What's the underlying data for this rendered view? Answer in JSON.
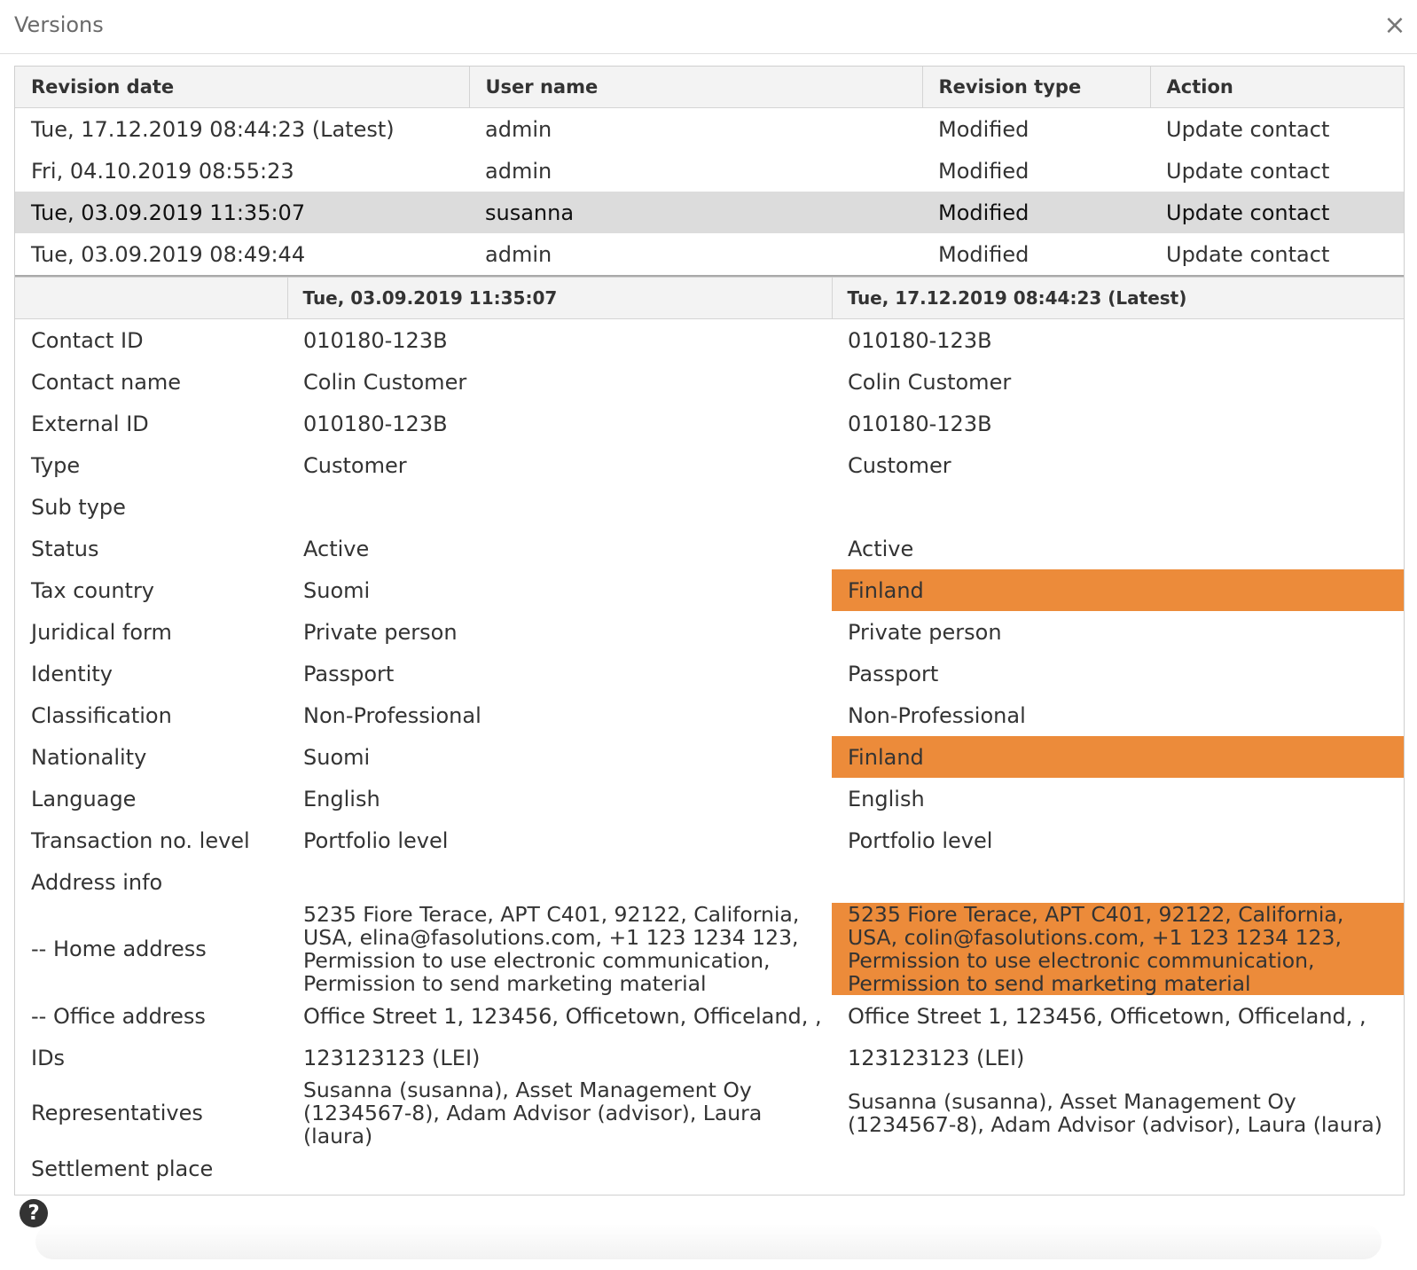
{
  "dialog": {
    "title": "Versions",
    "close_icon": "×",
    "help_icon": "?"
  },
  "colors": {
    "changed_highlight": "#ec8b3a",
    "selected_row": "#dcdcdc"
  },
  "revisions": {
    "headers": [
      "Revision date",
      "User name",
      "Revision type",
      "Action"
    ],
    "rows": [
      {
        "date": "Tue, 17.12.2019 08:44:23 (Latest)",
        "user": "admin",
        "type": "Modified",
        "action": "Update contact"
      },
      {
        "date": "Fri, 04.10.2019 08:55:23",
        "user": "admin",
        "type": "Modified",
        "action": "Update contact"
      },
      {
        "date": "Tue, 03.09.2019 11:35:07",
        "user": "susanna",
        "type": "Modified",
        "action": "Update contact",
        "selected": true
      },
      {
        "date": "Tue, 03.09.2019 08:49:44",
        "user": "admin",
        "type": "Modified",
        "action": "Update contact"
      }
    ]
  },
  "comparison": {
    "headers": [
      "",
      "Tue, 03.09.2019 11:35:07",
      "Tue, 17.12.2019 08:44:23 (Latest)"
    ],
    "rows": [
      {
        "label": "Contact ID",
        "old": "010180-123B",
        "new": "010180-123B",
        "changed": false
      },
      {
        "label": "Contact name",
        "old": "Colin Customer",
        "new": "Colin Customer",
        "changed": false
      },
      {
        "label": "External ID",
        "old": "010180-123B",
        "new": "010180-123B",
        "changed": false
      },
      {
        "label": "Type",
        "old": "Customer",
        "new": "Customer",
        "changed": false
      },
      {
        "label": "Sub type",
        "old": "",
        "new": "",
        "changed": false
      },
      {
        "label": "Status",
        "old": "Active",
        "new": "Active",
        "changed": false
      },
      {
        "label": "Tax country",
        "old": "Suomi",
        "new": "Finland",
        "changed": true
      },
      {
        "label": "Juridical form",
        "old": "Private person",
        "new": "Private person",
        "changed": false
      },
      {
        "label": "Identity",
        "old": "Passport",
        "new": "Passport",
        "changed": false
      },
      {
        "label": "Classification",
        "old": "Non-Professional",
        "new": "Non-Professional",
        "changed": false
      },
      {
        "label": "Nationality",
        "old": "Suomi",
        "new": "Finland",
        "changed": true
      },
      {
        "label": "Language",
        "old": "English",
        "new": "English",
        "changed": false
      },
      {
        "label": "Transaction no. level",
        "old": "Portfolio level",
        "new": "Portfolio level",
        "changed": false
      },
      {
        "label": "Address info",
        "old": "",
        "new": "",
        "changed": false
      },
      {
        "label": "-- Home address",
        "old": "5235 Fiore Terace, APT C401, 92122, California, USA, elina@fasolutions.com, +1 123 1234 123, Permission to use electronic communication, Permission to send marketing material",
        "new": "5235 Fiore Terace, APT C401, 92122, California, USA, colin@fasolutions.com, +1 123 1234 123, Permission to use electronic communication, Permission to send marketing material",
        "changed": true,
        "multiline": 4
      },
      {
        "label": "-- Office address",
        "old": "Office Street 1, 123456, Officetown, Officeland, ,",
        "new": "Office Street 1, 123456, Officetown, Officeland, ,",
        "changed": false
      },
      {
        "label": "IDs",
        "old": "123123123 (LEI)",
        "new": "123123123 (LEI)",
        "changed": false
      },
      {
        "label": "Representatives",
        "old": "Susanna (susanna), Asset Management Oy (1234567-8), Adam Advisor (advisor), Laura (laura)",
        "new": "Susanna (susanna), Asset Management Oy (1234567-8), Adam Advisor (advisor), Laura (laura)",
        "changed": false,
        "multiline": 2
      },
      {
        "label": "Settlement place",
        "old": "",
        "new": "",
        "changed": false
      }
    ]
  }
}
